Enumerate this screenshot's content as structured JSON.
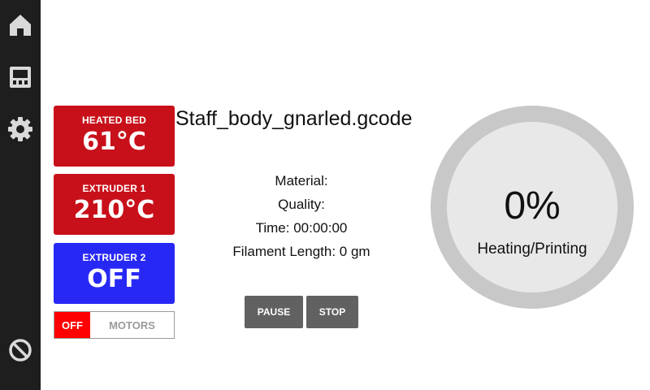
{
  "sidebar": {
    "icons": [
      "home-icon",
      "display-icon",
      "gear-icon",
      "cancel-icon"
    ]
  },
  "temperatures": {
    "heated_bed": {
      "label": "HEATED BED",
      "value": "61°C",
      "color": "#c8101a"
    },
    "extruder1": {
      "label": "EXTRUDER 1",
      "value": "210°C",
      "color": "#c8101a"
    },
    "extruder2": {
      "label": "EXTRUDER 2",
      "value": "OFF",
      "color": "#2828f5"
    }
  },
  "motors": {
    "state": "OFF",
    "label": "MOTORS",
    "state_color": "#ff0000"
  },
  "job": {
    "file_name": "Staff_body_gnarled.gcode",
    "material": "Material:",
    "quality": "Quality:",
    "time": "Time: 00:00:00",
    "filament": "Filament Length: 0 gm"
  },
  "controls": {
    "pause_label": "PAUSE",
    "stop_label": "STOP"
  },
  "progress": {
    "percent": "0%",
    "value": 0,
    "status": "Heating/Printing"
  }
}
